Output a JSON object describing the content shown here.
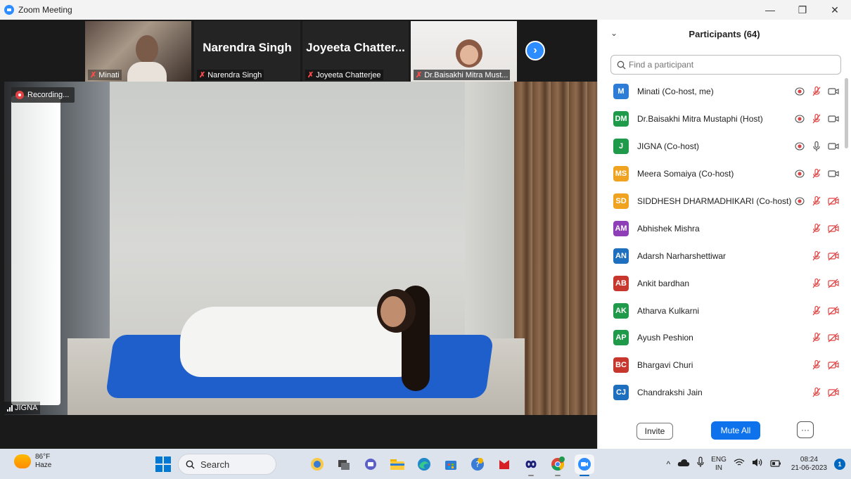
{
  "window": {
    "title": "Zoom Meeting",
    "controls": [
      "—",
      "❐",
      "✕"
    ]
  },
  "thumbnails": [
    {
      "label": "Minati",
      "big_name": ""
    },
    {
      "label": "Narendra Singh",
      "big_name": "Narendra Singh"
    },
    {
      "label": "Joyeeta Chatterjee",
      "big_name": "Joyeeta Chatter..."
    },
    {
      "label": "Dr.Baisakhi Mitra Must...",
      "big_name": ""
    }
  ],
  "recording": {
    "label": "Recording..."
  },
  "active_speaker": {
    "label": "JIGNA"
  },
  "participants_panel": {
    "title": "Participants (64)",
    "search_placeholder": "Find a participant",
    "participants": [
      {
        "initials": "M",
        "name": "Minati (Co-host, me)",
        "color": "#2d7cd6",
        "recording": true,
        "mic": "muted",
        "video": "on"
      },
      {
        "initials": "DM",
        "name": "Dr.Baisakhi Mitra Mustaphi (Host)",
        "color": "#1f9a4a",
        "recording": true,
        "mic": "muted",
        "video": "on"
      },
      {
        "initials": "J",
        "name": "JIGNA (Co-host)",
        "color": "#1f9a4a",
        "recording": true,
        "mic": "on",
        "video": "on"
      },
      {
        "initials": "MS",
        "name": "Meera Somaiya (Co-host)",
        "color": "#f0a321",
        "recording": true,
        "mic": "muted",
        "video": "on"
      },
      {
        "initials": "SD",
        "name": "SIDDHESH DHARMADHIKARI (Co-host)",
        "color": "#f0a321",
        "recording": true,
        "mic": "muted",
        "video": "off"
      },
      {
        "initials": "AM",
        "name": "Abhishek Mishra",
        "color": "#8e3fb8",
        "recording": false,
        "mic": "muted",
        "video": "off"
      },
      {
        "initials": "AN",
        "name": "Adarsh Narharshettiwar",
        "color": "#1f6fbf",
        "recording": false,
        "mic": "muted",
        "video": "off"
      },
      {
        "initials": "AB",
        "name": "Ankit bardhan",
        "color": "#c8372d",
        "recording": false,
        "mic": "muted",
        "video": "off"
      },
      {
        "initials": "AK",
        "name": "Atharva Kulkarni",
        "color": "#1f9a4a",
        "recording": false,
        "mic": "muted",
        "video": "off"
      },
      {
        "initials": "AP",
        "name": "Ayush Peshion",
        "color": "#1f9a4a",
        "recording": false,
        "mic": "muted",
        "video": "off"
      },
      {
        "initials": "BC",
        "name": "Bhargavi Churi",
        "color": "#c8372d",
        "recording": false,
        "mic": "muted",
        "video": "off"
      },
      {
        "initials": "CJ",
        "name": "Chandrakshi Jain",
        "color": "#1f6fbf",
        "recording": false,
        "mic": "muted",
        "video": "off"
      }
    ],
    "footer": {
      "invite": "Invite",
      "mute_all": "Mute All",
      "more": "···"
    }
  },
  "taskbar": {
    "weather": {
      "temp": "86°F",
      "condition": "Haze"
    },
    "search_label": "Search",
    "tray": {
      "lang_top": "ENG",
      "lang_bottom": "IN",
      "time": "08:24",
      "date": "21-06-2023",
      "notifications": "1"
    }
  }
}
